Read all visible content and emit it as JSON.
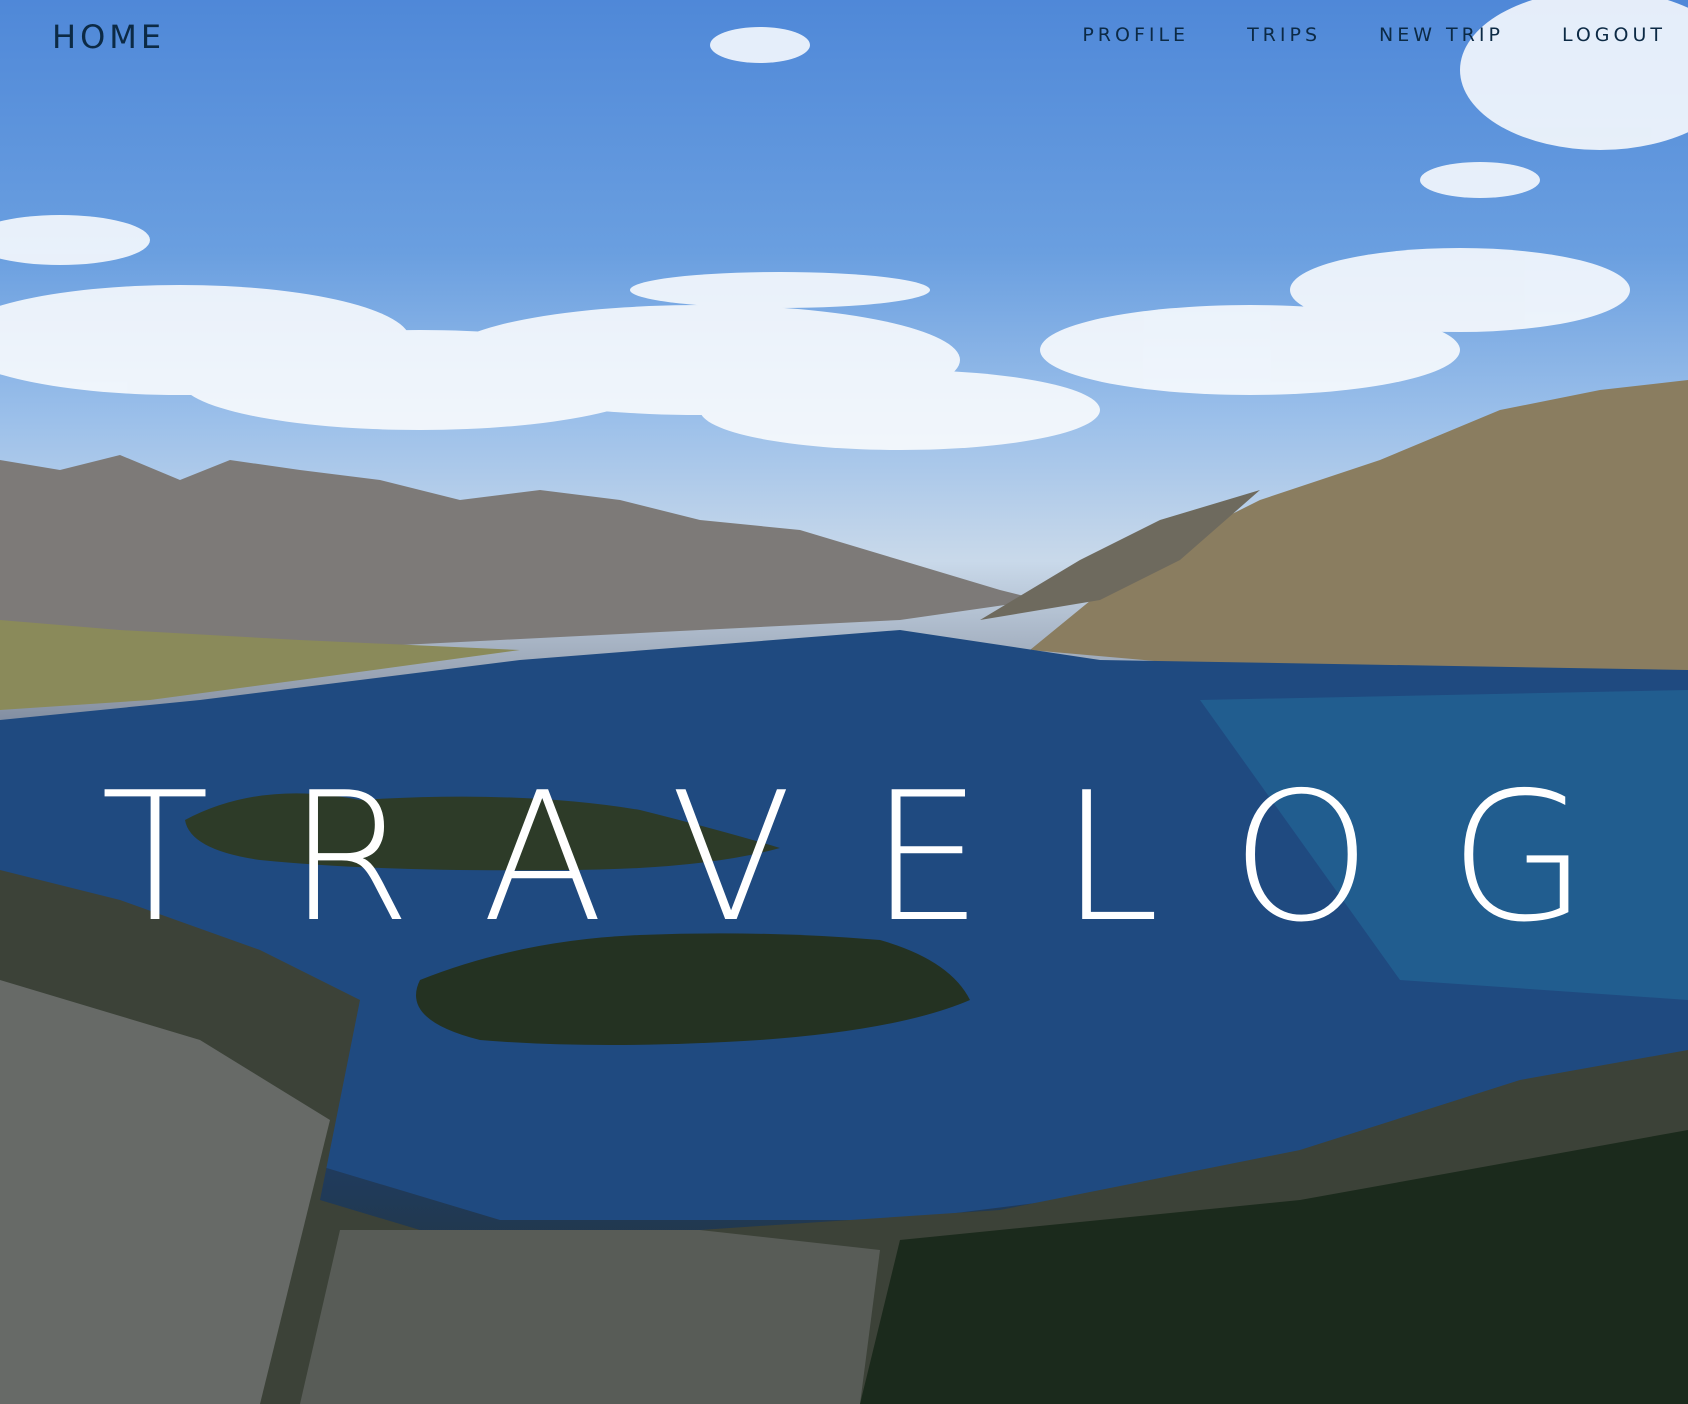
{
  "nav": {
    "home_label": "HOME",
    "links": [
      {
        "label": "PROFILE"
      },
      {
        "label": "TRIPS"
      },
      {
        "label": "NEW TRIP"
      },
      {
        "label": "LOGOUT"
      }
    ]
  },
  "hero": {
    "title": "TRAVELOG"
  },
  "colors": {
    "nav_text": "#0c2a45",
    "title_text": "#ffffff",
    "sky": "#4f88d8",
    "lake": "#1e4274"
  }
}
